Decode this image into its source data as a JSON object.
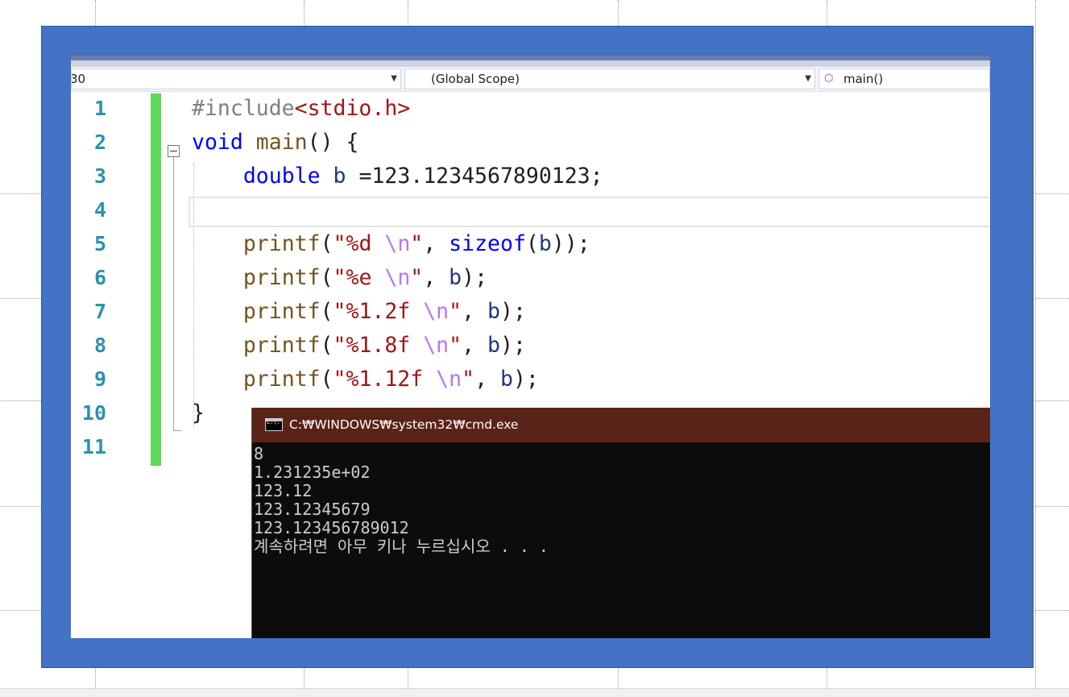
{
  "navbar": {
    "project_combo": "30",
    "scope_combo": "(Global Scope)",
    "member_combo": "main()"
  },
  "editor": {
    "line_numbers": [
      "1",
      "2",
      "3",
      "4",
      "5",
      "6",
      "7",
      "8",
      "9",
      "10",
      "11"
    ],
    "code": {
      "l1_pp": "#include",
      "l1_inc": "<stdio.h>",
      "l2_kw": "void",
      "l2_fn": "main",
      "l2_rest": "() {",
      "l3_kw": "double",
      "l3_var": "b",
      "l3_rest": " =123.1234567890123;",
      "l5_fn": "printf",
      "l5_str1": "\"%d ",
      "l5_esc": "\\n",
      "l5_str2": "\"",
      "l5_kw": "sizeof",
      "l5_var": "b",
      "l6_fn": "printf",
      "l6_str1": "\"%e ",
      "l6_esc": "\\n",
      "l6_str2": "\"",
      "l6_var": "b",
      "l7_fn": "printf",
      "l7_str1": "\"%1.2f ",
      "l7_esc": "\\n",
      "l7_str2": "\"",
      "l7_var": "b",
      "l8_fn": "printf",
      "l8_str1": "\"%1.8f ",
      "l8_esc": "\\n",
      "l8_str2": "\"",
      "l8_var": "b",
      "l9_fn": "printf",
      "l9_str1": "\"%1.12f ",
      "l9_esc": "\\n",
      "l9_str2": "\"",
      "l9_var": "b",
      "l10": "}"
    }
  },
  "console": {
    "title": "C:₩WINDOWS₩system32₩cmd.exe",
    "icon_text": "C:\\.",
    "lines": [
      "8",
      "1.231235e+02",
      "123.12",
      "123.12345679",
      "123.123456789012",
      "계속하려면 아무 키나 누르십시오 . . ."
    ]
  },
  "colors": {
    "frame": "#4472c4",
    "line_number": "#2b91af",
    "change_bar": "#5dd85b",
    "console_titlebar": "#5a2317",
    "console_bg": "#0c0c0c"
  }
}
